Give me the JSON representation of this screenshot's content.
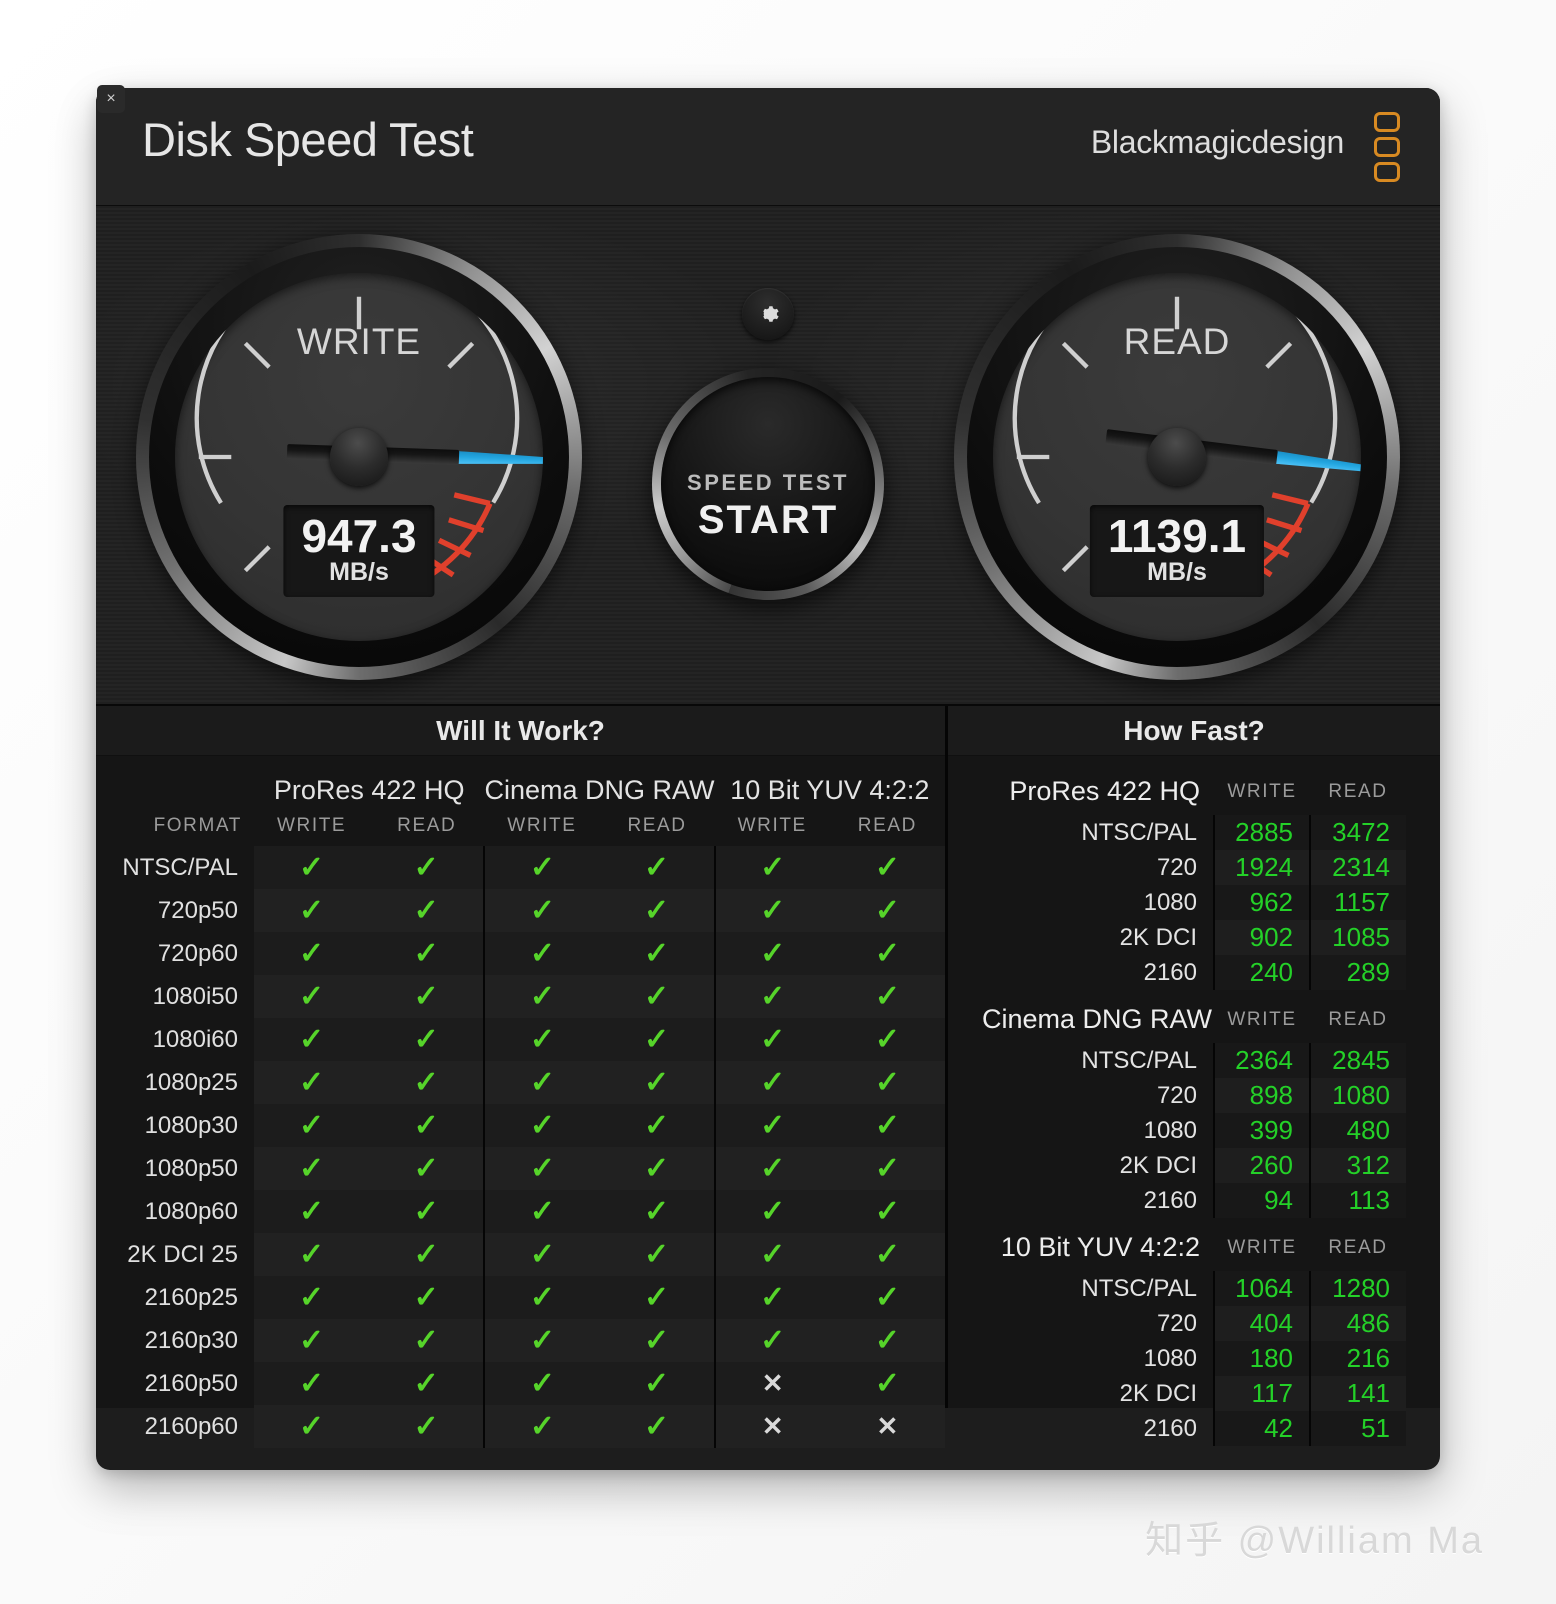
{
  "window": {
    "title": "Disk Speed Test",
    "brand": "Blackmagicdesign",
    "close_label": "×"
  },
  "gauges": {
    "write": {
      "label": "WRITE",
      "value": "947.3",
      "unit": "MB/s",
      "needle_angle_deg": 182
    },
    "read": {
      "label": "READ",
      "value": "1139.1",
      "unit": "MB/s",
      "needle_angle_deg": 187
    }
  },
  "start_button": {
    "line1": "SPEED TEST",
    "line2": "START"
  },
  "gear_button": {
    "icon": "gear-icon"
  },
  "will_it_work": {
    "title": "Will It Work?",
    "format_header": "FORMAT",
    "codecs": [
      "ProRes 422 HQ",
      "Cinema DNG RAW",
      "10 Bit YUV 4:2:2"
    ],
    "sub_headers": [
      "WRITE",
      "READ"
    ],
    "pass_glyph": "✓",
    "fail_glyph": "✕",
    "rows": [
      {
        "format": "NTSC/PAL",
        "cells": [
          true,
          true,
          true,
          true,
          true,
          true
        ]
      },
      {
        "format": "720p50",
        "cells": [
          true,
          true,
          true,
          true,
          true,
          true
        ]
      },
      {
        "format": "720p60",
        "cells": [
          true,
          true,
          true,
          true,
          true,
          true
        ]
      },
      {
        "format": "1080i50",
        "cells": [
          true,
          true,
          true,
          true,
          true,
          true
        ]
      },
      {
        "format": "1080i60",
        "cells": [
          true,
          true,
          true,
          true,
          true,
          true
        ]
      },
      {
        "format": "1080p25",
        "cells": [
          true,
          true,
          true,
          true,
          true,
          true
        ]
      },
      {
        "format": "1080p30",
        "cells": [
          true,
          true,
          true,
          true,
          true,
          true
        ]
      },
      {
        "format": "1080p50",
        "cells": [
          true,
          true,
          true,
          true,
          true,
          true
        ]
      },
      {
        "format": "1080p60",
        "cells": [
          true,
          true,
          true,
          true,
          true,
          true
        ]
      },
      {
        "format": "2K DCI 25",
        "cells": [
          true,
          true,
          true,
          true,
          true,
          true
        ]
      },
      {
        "format": "2160p25",
        "cells": [
          true,
          true,
          true,
          true,
          true,
          true
        ]
      },
      {
        "format": "2160p30",
        "cells": [
          true,
          true,
          true,
          true,
          true,
          true
        ]
      },
      {
        "format": "2160p50",
        "cells": [
          true,
          true,
          true,
          true,
          false,
          true
        ]
      },
      {
        "format": "2160p60",
        "cells": [
          true,
          true,
          true,
          true,
          false,
          false
        ]
      }
    ]
  },
  "how_fast": {
    "title": "How Fast?",
    "write_header": "WRITE",
    "read_header": "READ",
    "groups": [
      {
        "name": "ProRes 422 HQ",
        "rows": [
          {
            "res": "NTSC/PAL",
            "write": "2885",
            "read": "3472"
          },
          {
            "res": "720",
            "write": "1924",
            "read": "2314"
          },
          {
            "res": "1080",
            "write": "962",
            "read": "1157"
          },
          {
            "res": "2K DCI",
            "write": "902",
            "read": "1085"
          },
          {
            "res": "2160",
            "write": "240",
            "read": "289"
          }
        ]
      },
      {
        "name": "Cinema DNG RAW",
        "rows": [
          {
            "res": "NTSC/PAL",
            "write": "2364",
            "read": "2845"
          },
          {
            "res": "720",
            "write": "898",
            "read": "1080"
          },
          {
            "res": "1080",
            "write": "399",
            "read": "480"
          },
          {
            "res": "2K DCI",
            "write": "260",
            "read": "312"
          },
          {
            "res": "2160",
            "write": "94",
            "read": "113"
          }
        ]
      },
      {
        "name": "10 Bit YUV 4:2:2",
        "rows": [
          {
            "res": "NTSC/PAL",
            "write": "1064",
            "read": "1280"
          },
          {
            "res": "720",
            "write": "404",
            "read": "486"
          },
          {
            "res": "1080",
            "write": "180",
            "read": "216"
          },
          {
            "res": "2K DCI",
            "write": "117",
            "read": "141"
          },
          {
            "res": "2160",
            "write": "42",
            "read": "51"
          }
        ]
      }
    ]
  },
  "watermark": "知乎 @William Ma",
  "colors": {
    "needle_blue": "#23a6e0",
    "pass_green": "#56d42a",
    "value_green": "#24d128",
    "redzone": "#e0402c",
    "brand_orange": "#d88a22"
  }
}
